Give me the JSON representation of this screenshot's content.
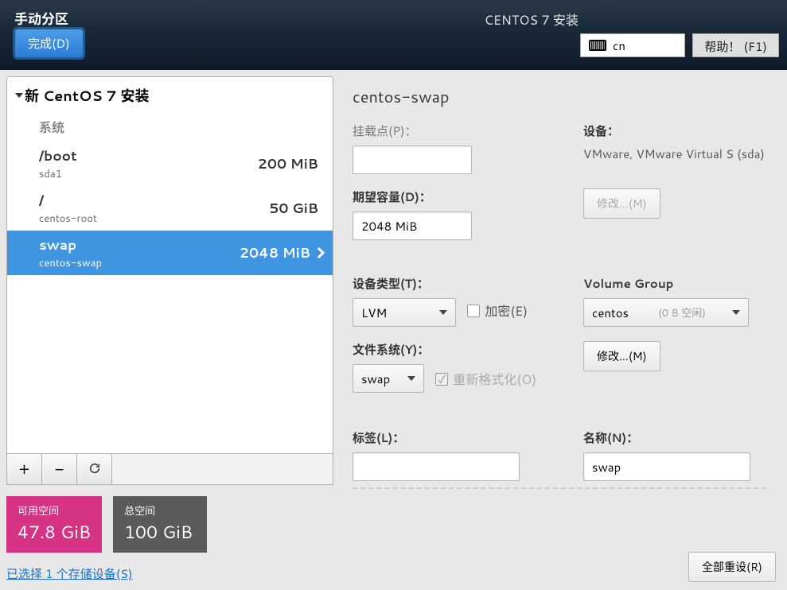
{
  "topbar": {
    "title": "手动分区",
    "done": "完成(D)",
    "installer_title": "CENTOS 7 安装",
    "lang": "cn",
    "help": "帮助！ (F1)"
  },
  "tree": {
    "header": "新 CentOS 7 安装",
    "system_label": "系统",
    "partitions": [
      {
        "name": "/boot",
        "dev": "sda1",
        "size": "200 MiB",
        "selected": false
      },
      {
        "name": "/",
        "dev": "centos-root",
        "size": "50 GiB",
        "selected": false
      },
      {
        "name": "swap",
        "dev": "centos-swap",
        "size": "2048 MiB",
        "selected": true
      }
    ]
  },
  "toolbar": {
    "add": "+",
    "remove": "−"
  },
  "space": {
    "avail_label": "可用空间",
    "avail_value": "47.8 GiB",
    "total_label": "总空间",
    "total_value": "100 GiB"
  },
  "disk_link": "已选择 1 个存储设备(S)",
  "detail": {
    "heading": "centos-swap",
    "mount_label": "挂载点(P)：",
    "mount_value": "",
    "device_label": "设备：",
    "device_text": "VMware, VMware Virtual S (sda)",
    "modify1": "修改...(M)",
    "capacity_label": "期望容量(D)：",
    "capacity_value": "2048 MiB",
    "dtype_label": "设备类型(T)：",
    "dtype_value": "LVM",
    "encrypt_label": "加密(E)",
    "vg_label": "Volume Group",
    "vg_value": "centos",
    "vg_free": "(0 B 空闲)",
    "modify2": "修改...(M)",
    "fs_label": "文件系统(Y)：",
    "fs_value": "swap",
    "reformat_label": "重新格式化(O)",
    "tag_label": "标签(L)：",
    "tag_value": "",
    "name_label": "名称(N)：",
    "name_value": "swap",
    "reset_all": "全部重设(R)"
  }
}
